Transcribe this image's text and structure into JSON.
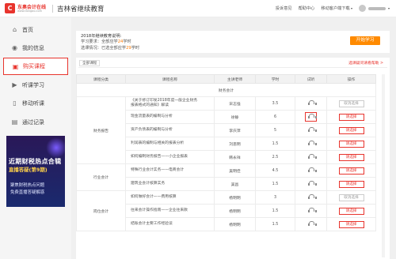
{
  "header": {
    "logo_mark": "C",
    "logo_name": "东奥会计在线",
    "logo_url": "www.dongao.com",
    "site_title": "吉林省继续教育",
    "nav": {
      "feedback": "投诉意见",
      "help": "帮助中心",
      "app_download": "移动客户端下载"
    }
  },
  "sidebar": {
    "items": [
      {
        "label": "首页",
        "icon": "home-icon"
      },
      {
        "label": "我的信息",
        "icon": "user-icon"
      },
      {
        "label": "购买课程",
        "icon": "cart-icon",
        "active": true
      },
      {
        "label": "听课学习",
        "icon": "play-icon"
      },
      {
        "label": "移动听课",
        "icon": "mobile-icon"
      },
      {
        "label": "通过记录",
        "icon": "record-icon"
      }
    ],
    "banner": {
      "line1": "近期财税热点合辑",
      "line2": "直播答疑(第9期)",
      "line3": "聚焦财税热点问题",
      "line4": "免费直播答疑解惑"
    }
  },
  "info": {
    "title": "2018年继续教育说明:",
    "req_label": "学习要求：",
    "req_text_1": "全部应学",
    "req_hours": "24",
    "req_text_2": "学时",
    "status_label": "选课情况：",
    "status_text_1": "已选全部应学",
    "status_hours": "29",
    "status_text_2": "学时",
    "start_button": "开始学习"
  },
  "panel": {
    "category_tag": "全部课程",
    "help_link": "选课疑问请看帮助 >",
    "columns": [
      "课程分类",
      "课程名称",
      "主讲老师",
      "学时",
      "试听",
      "操作"
    ],
    "group_header": "财务会计",
    "rows": [
      {
        "category": "财务报告",
        "name_l1": "《关于修订印发2018年度一般企业财务",
        "name_l2": "报表格式的通知》解读",
        "teacher": "宋志强",
        "hours": "3.5",
        "action": "取消选择",
        "action_type": "cancel"
      },
      {
        "name_l1": "现金流量表的编制与分析",
        "teacher": "徐静",
        "hours": "6",
        "action": "请选择",
        "action_type": "select",
        "highlight": true
      },
      {
        "name_l1": "资产负债表的编制与分析",
        "teacher": "李庆萍",
        "hours": "5",
        "action": "请选择",
        "action_type": "select"
      },
      {
        "name_l1": "利润表的编制与相关的报表分析",
        "teacher": "刘思明",
        "hours": "1.5",
        "action": "请选择",
        "action_type": "select"
      },
      {
        "name_l1": "如何编制财务报告——小企业报表",
        "teacher": "韩永祥",
        "hours": "2.5",
        "action": "请选择",
        "action_type": "select"
      },
      {
        "category": "行业会计",
        "name_l1": "特殊行业会计实务——电商会计",
        "teacher": "吴明佳",
        "hours": "4.5",
        "action": "请选择",
        "action_type": "select"
      },
      {
        "name_l1": "建筑业会计核算实务",
        "teacher": "吴昌",
        "hours": "1.5",
        "action": "请选择",
        "action_type": "select"
      },
      {
        "category": "岗位会计",
        "name_l1": "如何做好会计——费用核算",
        "teacher": "杨明明",
        "hours": "3",
        "action": "取消选择",
        "action_type": "cancel"
      },
      {
        "name_l1": "往来会计操作指南——企业往来款",
        "teacher": "杨明明",
        "hours": "1.5",
        "action": "请选择",
        "action_type": "select"
      },
      {
        "name_l1": "结账会计主要工作经验谈",
        "teacher": "杨明明",
        "hours": "1.5",
        "action": "请选择",
        "action_type": "select"
      }
    ]
  }
}
